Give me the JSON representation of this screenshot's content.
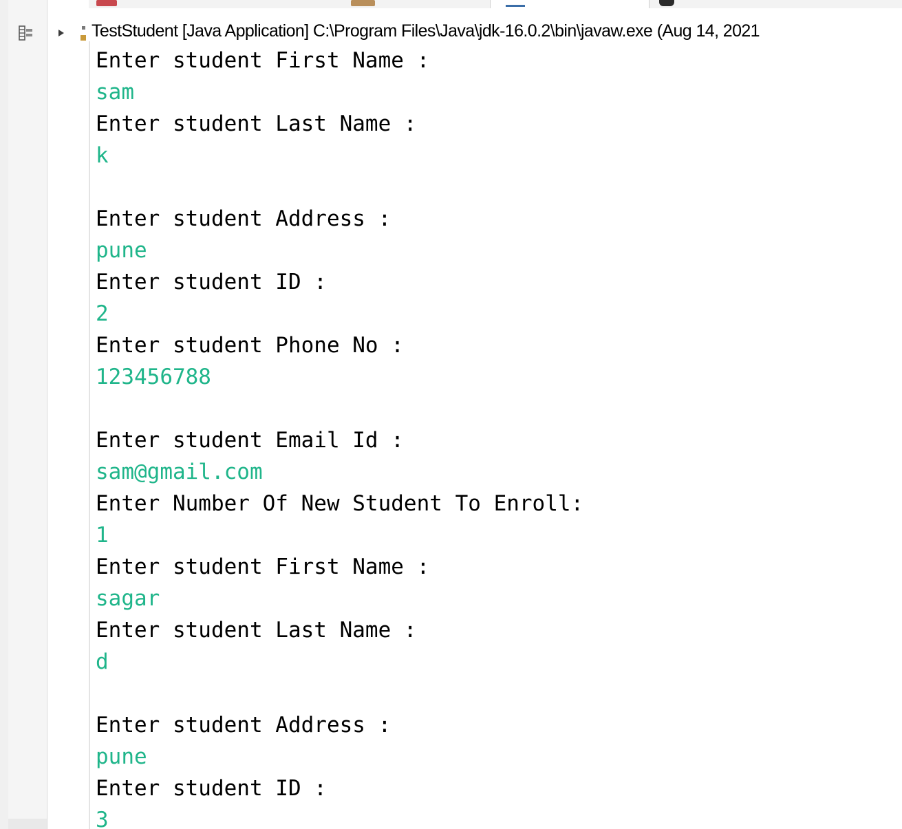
{
  "console": {
    "header": "TestStudent [Java Application] C:\\Program Files\\Java\\jdk-16.0.2\\bin\\javaw.exe  (Aug 14, 2021",
    "lines": [
      {
        "text": "Enter student First Name :",
        "kind": "prompt"
      },
      {
        "text": "sam",
        "kind": "input"
      },
      {
        "text": "Enter student Last Name :",
        "kind": "prompt"
      },
      {
        "text": "k",
        "kind": "input"
      },
      {
        "text": "",
        "kind": "blank"
      },
      {
        "text": "Enter student Address :",
        "kind": "prompt"
      },
      {
        "text": "pune",
        "kind": "input"
      },
      {
        "text": "Enter student ID :",
        "kind": "prompt"
      },
      {
        "text": "2",
        "kind": "input"
      },
      {
        "text": "Enter student Phone No :",
        "kind": "prompt"
      },
      {
        "text": "123456788",
        "kind": "input"
      },
      {
        "text": "",
        "kind": "blank"
      },
      {
        "text": "Enter student Email Id :",
        "kind": "prompt"
      },
      {
        "text": "sam@gmail.com",
        "kind": "input"
      },
      {
        "text": "Enter Number Of New Student To Enroll:",
        "kind": "prompt"
      },
      {
        "text": "1",
        "kind": "input"
      },
      {
        "text": "Enter student First Name :",
        "kind": "prompt"
      },
      {
        "text": "sagar",
        "kind": "input"
      },
      {
        "text": "Enter student Last Name :",
        "kind": "prompt"
      },
      {
        "text": "d",
        "kind": "input"
      },
      {
        "text": "",
        "kind": "blank"
      },
      {
        "text": "Enter student Address :",
        "kind": "prompt"
      },
      {
        "text": "pune",
        "kind": "input"
      },
      {
        "text": "Enter student ID :",
        "kind": "prompt"
      },
      {
        "text": "3",
        "kind": "input"
      }
    ]
  },
  "icons": {
    "layout": "layout-icon",
    "expand": "expand-arrow-icon"
  },
  "colors": {
    "prompt": "#000000",
    "input": "#1fb58a",
    "background": "#ffffff"
  }
}
